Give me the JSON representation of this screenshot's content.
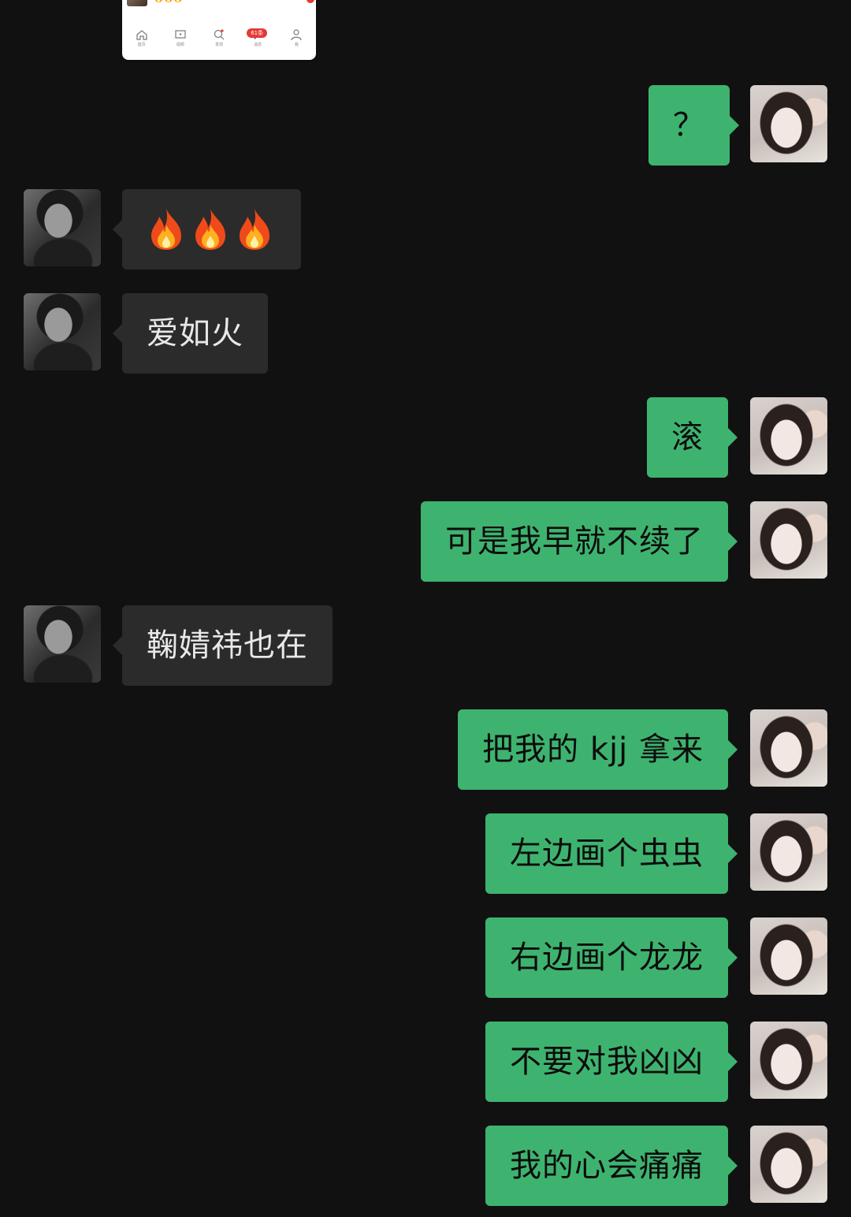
{
  "shared_screenshot": {
    "mini_emoji": "🔥🔥🔥",
    "tab_badge": "61条",
    "tabs": [
      {
        "icon": "home-icon",
        "label": "首页"
      },
      {
        "icon": "video-icon",
        "label": "视频"
      },
      {
        "icon": "discover-icon",
        "label": "发现"
      },
      {
        "icon": "message-icon",
        "label": "消息"
      },
      {
        "icon": "profile-icon",
        "label": "我"
      }
    ]
  },
  "colors": {
    "background": "#111111",
    "outgoing_bubble": "#3eb36f",
    "incoming_bubble": "#2b2b2b"
  },
  "messages": [
    {
      "side": "out",
      "text": "？"
    },
    {
      "side": "in",
      "type": "emoji",
      "text": "🔥🔥🔥"
    },
    {
      "side": "in",
      "text": "爱如火"
    },
    {
      "side": "out",
      "text": "滚"
    },
    {
      "side": "out",
      "text": "可是我早就不续了"
    },
    {
      "side": "in",
      "text": "鞠婧祎也在"
    },
    {
      "side": "out",
      "text": "把我的 kjj 拿来"
    },
    {
      "side": "out",
      "text": "左边画个虫虫"
    },
    {
      "side": "out",
      "text": "右边画个龙龙"
    },
    {
      "side": "out",
      "text": "不要对我凶凶"
    },
    {
      "side": "out",
      "text": "我的心会痛痛"
    }
  ]
}
